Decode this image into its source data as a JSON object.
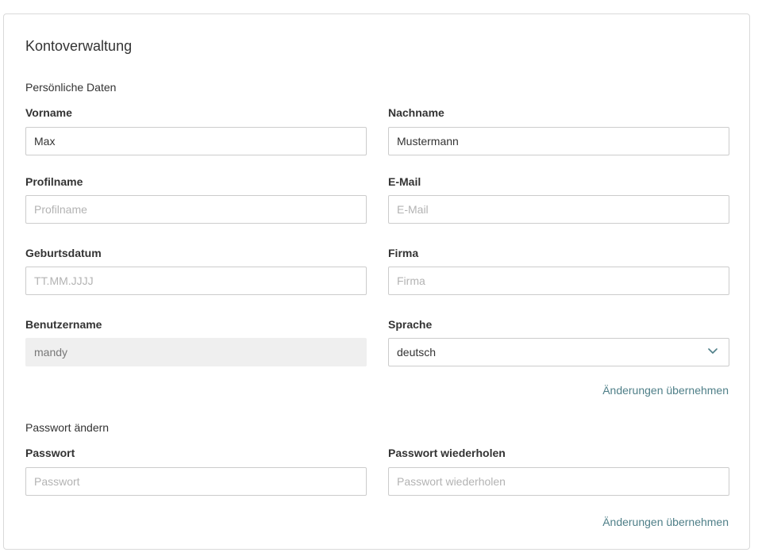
{
  "title": "Kontoverwaltung",
  "personal": {
    "section_title": "Persönliche Daten",
    "firstname": {
      "label": "Vorname",
      "value": "Max",
      "placeholder": ""
    },
    "lastname": {
      "label": "Nachname",
      "value": "Mustermann",
      "placeholder": ""
    },
    "profilename": {
      "label": "Profilname",
      "value": "",
      "placeholder": "Profilname"
    },
    "email": {
      "label": "E-Mail",
      "value": "",
      "placeholder": "E-Mail"
    },
    "birthdate": {
      "label": "Geburtsdatum",
      "value": "",
      "placeholder": "TT.MM.JJJJ"
    },
    "company": {
      "label": "Firma",
      "value": "",
      "placeholder": "Firma"
    },
    "username": {
      "label": "Benutzername",
      "value": "mandy"
    },
    "language": {
      "label": "Sprache",
      "value": "deutsch"
    },
    "apply_label": "Änderungen übernehmen"
  },
  "password": {
    "section_title": "Passwort ändern",
    "password": {
      "label": "Passwort",
      "placeholder": "Passwort"
    },
    "password_repeat": {
      "label": "Passwort wiederholen",
      "placeholder": "Passwort wiederholen"
    },
    "apply_label": "Änderungen übernehmen"
  },
  "icons": {
    "language_dropdown": "chevron-down-icon"
  },
  "colors": {
    "link": "#4f7f88",
    "border": "#cccccc",
    "disabled_bg": "#efefef"
  }
}
